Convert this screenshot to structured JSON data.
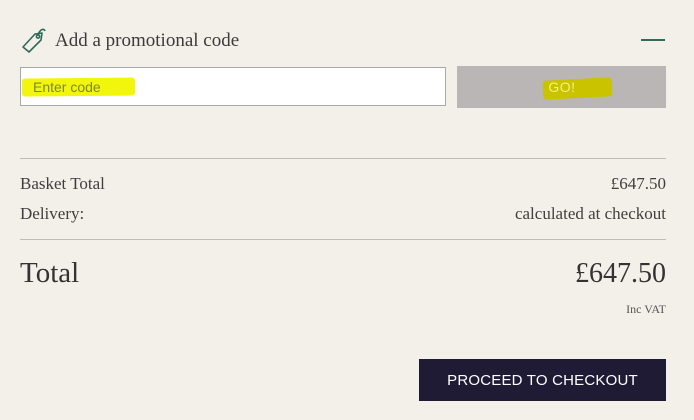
{
  "promo": {
    "title": "Add a promotional code",
    "input_placeholder": "Enter code",
    "go_label": "GO!",
    "icon": "tag-icon",
    "collapse_icon": "minus-icon"
  },
  "summary": {
    "basket_label": "Basket Total",
    "basket_value": "£647.50",
    "delivery_label": "Delivery:",
    "delivery_value": "calculated at checkout",
    "total_label": "Total",
    "total_value": "£647.50",
    "vat_note": "Inc VAT"
  },
  "actions": {
    "checkout_label": "PROCEED TO CHECKOUT"
  },
  "colors": {
    "background": "#f3f0e9",
    "accent_green": "#2e6b58",
    "checkout_bg": "#1f1b35",
    "go_bg": "#bab6b6",
    "highlight_yellow": "#f1f500"
  }
}
